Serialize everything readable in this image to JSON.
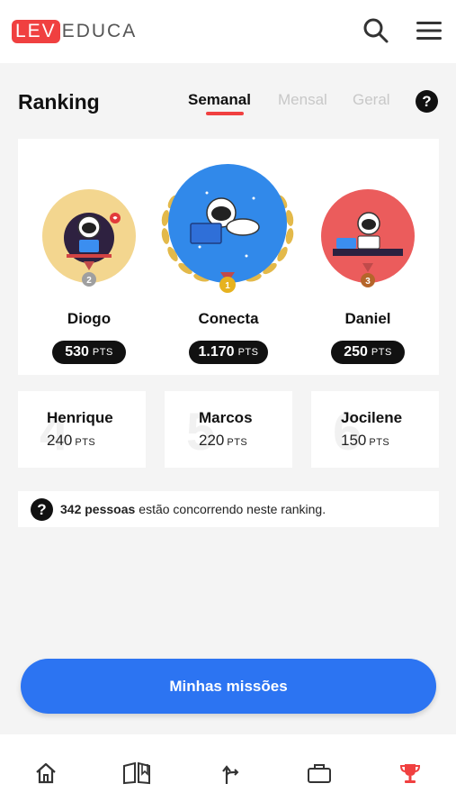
{
  "brand": {
    "part1": "LEV",
    "part2": "EDUCA"
  },
  "header": {
    "title": "Ranking"
  },
  "tabs": [
    {
      "label": "Semanal",
      "active": true
    },
    {
      "label": "Mensal",
      "active": false
    },
    {
      "label": "Geral",
      "active": false
    }
  ],
  "podium": [
    {
      "rank": "2",
      "name": "Diogo",
      "points": "530",
      "unit": "PTS"
    },
    {
      "rank": "1",
      "name": "Conecta",
      "points": "1.170",
      "unit": "PTS"
    },
    {
      "rank": "3",
      "name": "Daniel",
      "points": "250",
      "unit": "PTS"
    }
  ],
  "others": [
    {
      "rank": "4",
      "name": "Henrique",
      "points": "240",
      "unit": "PTS"
    },
    {
      "rank": "5",
      "name": "Marcos",
      "points": "220",
      "unit": "PTS"
    },
    {
      "rank": "6",
      "name": "Jocilene",
      "points": "150",
      "unit": "PTS"
    }
  ],
  "info": {
    "count": "342 pessoas",
    "text": "estão concorrendo neste ranking."
  },
  "missions_button": "Minhas missões",
  "colors": {
    "brand_red": "#f04040",
    "primary_blue": "#2c74f2",
    "gold": "#e6b21f",
    "silver": "#a5a5a5",
    "bronze": "#b5652a"
  },
  "icons": [
    "search-icon",
    "menu-icon",
    "help-icon",
    "home-icon",
    "book-icon",
    "path-icon",
    "briefcase-icon",
    "trophy-icon"
  ]
}
